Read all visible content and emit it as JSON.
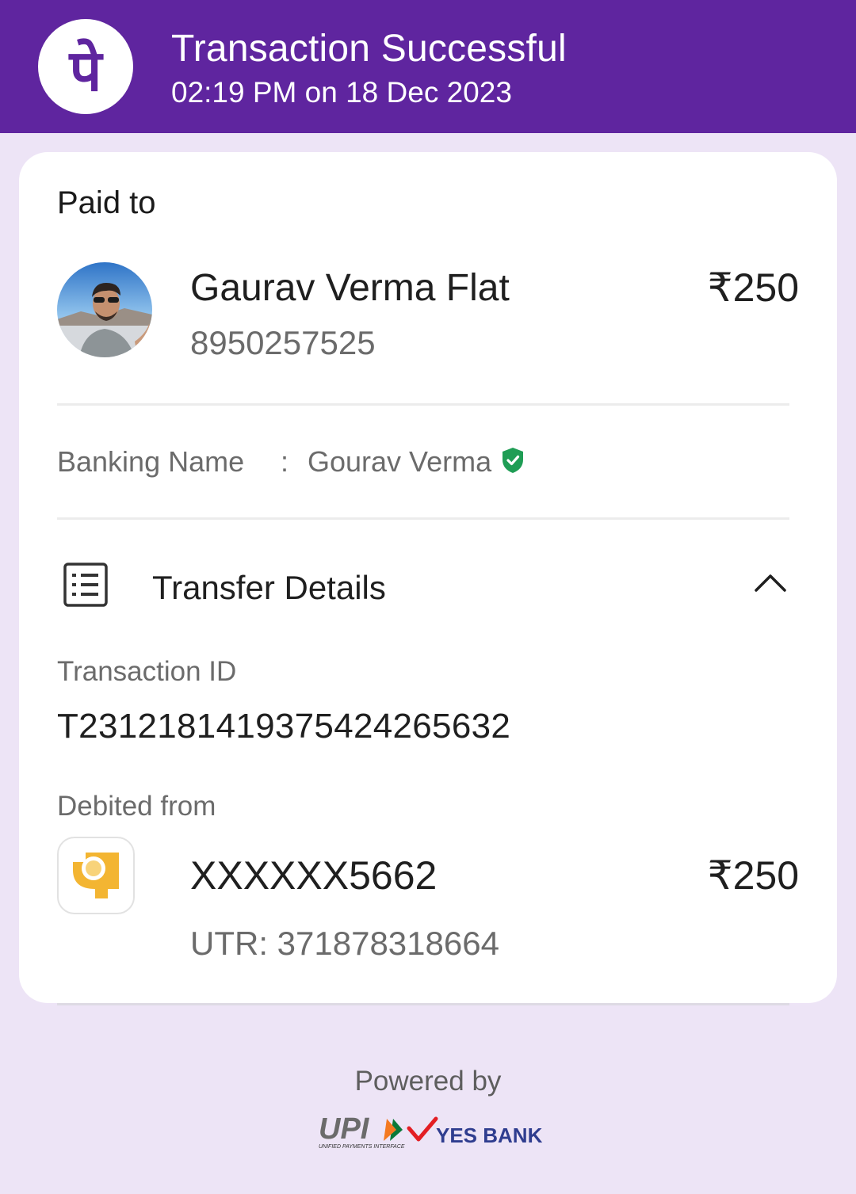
{
  "header": {
    "title": "Transaction Successful",
    "subtitle": "02:19 PM on 18 Dec 2023",
    "logo_glyph": "पे",
    "brand_color": "#5f259f"
  },
  "card": {
    "paid_to_label": "Paid to",
    "payee": {
      "name": "Gaurav Verma Flat",
      "phone": "8950257525",
      "amount": "₹250"
    },
    "banking": {
      "label": "Banking Name",
      "separator": ":",
      "value": "Gourav Verma",
      "verified_icon": "shield-check-icon",
      "verified_color": "#1f9d55"
    },
    "transfer_details": {
      "title": "Transfer Details",
      "icon": "list-icon",
      "toggle_icon": "chevron-up-icon"
    },
    "transaction_id": {
      "label": "Transaction ID",
      "value": "T2312181419375424265632"
    },
    "debited": {
      "label": "Debited from",
      "account": "XXXXXX5662",
      "amount": "₹250",
      "utr": "UTR: 371878318664",
      "bank_icon": "bank-logo-icon",
      "bank_color": "#f3b532"
    }
  },
  "footer": {
    "powered_by": "Powered by",
    "upi_logo_text": "UPI",
    "upi_tagline": "UNIFIED PAYMENTS INTERFACE",
    "bank_logo_text": "YES BANK"
  }
}
